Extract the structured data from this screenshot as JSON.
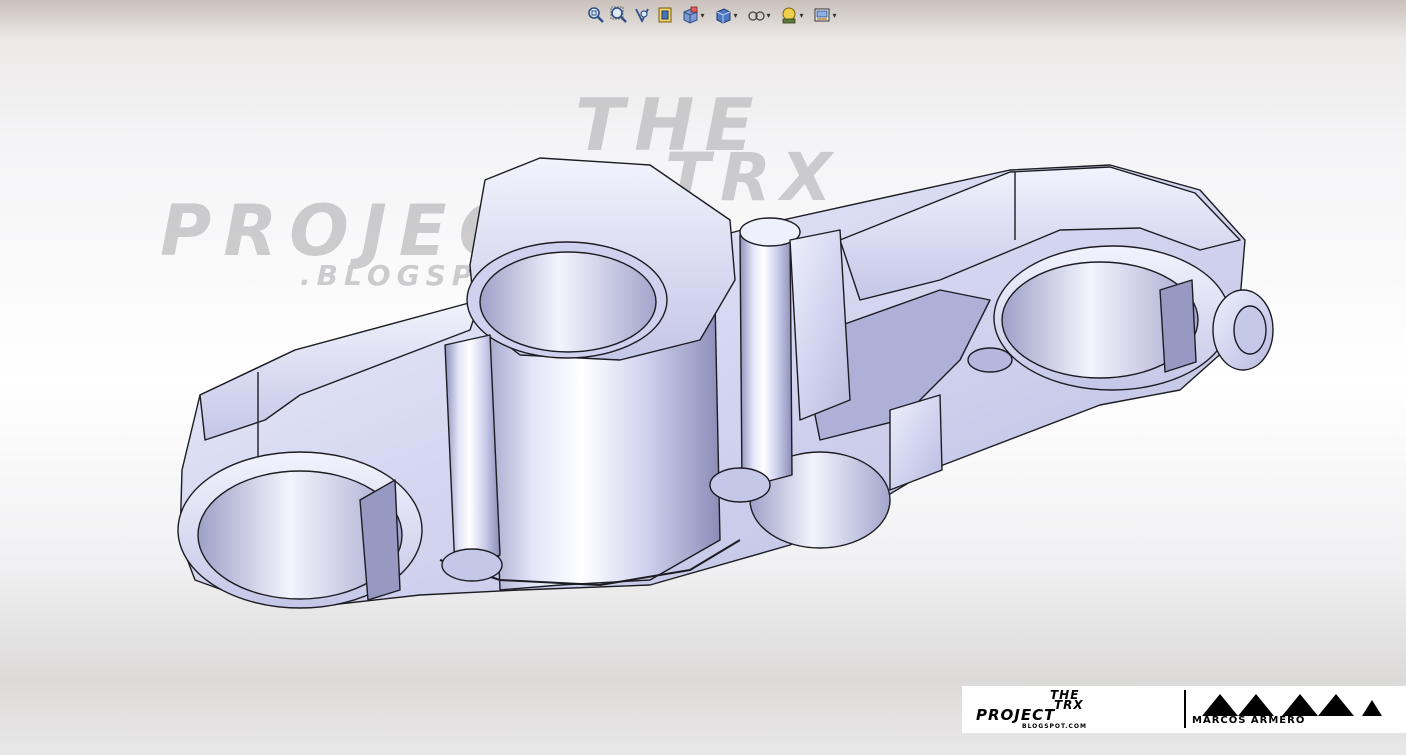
{
  "viewport": {
    "toolbar": {
      "items": [
        {
          "name": "zoom-to-fit-icon",
          "dropdown": false
        },
        {
          "name": "zoom-to-area-icon",
          "dropdown": false
        },
        {
          "name": "previous-view-icon",
          "dropdown": false
        },
        {
          "name": "section-view-icon",
          "dropdown": false
        },
        {
          "name": "view-orientation-icon",
          "dropdown": true
        },
        {
          "name": "display-style-icon",
          "dropdown": true
        },
        {
          "name": "hide-show-items-icon",
          "dropdown": true
        },
        {
          "name": "edit-appearance-icon",
          "dropdown": true
        },
        {
          "name": "apply-scene-icon",
          "dropdown": true
        }
      ],
      "caret": "▾"
    },
    "watermark": {
      "line1": "THE",
      "line2": "TRX",
      "line3": "PROJECT",
      "line4": ".BLOGSPOT.COM"
    },
    "logo": {
      "the": "THE",
      "trx": "TRX",
      "project": "PROJECT",
      "blog": "BLOGSPOT.COM",
      "name": "MARCOS ARMERO"
    }
  },
  "colors": {
    "model_face": "#d8d9f2",
    "model_edge": "#1c1c22",
    "model_shadow": "#7c7ea8",
    "watermark": "#b9b9bb"
  }
}
